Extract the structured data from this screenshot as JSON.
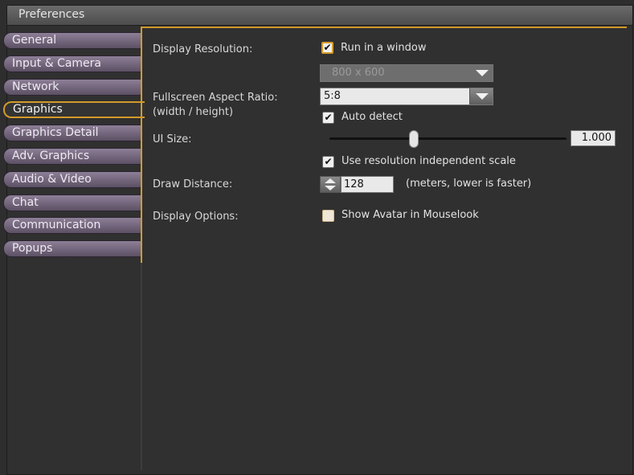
{
  "window": {
    "title": "Preferences"
  },
  "tabs": [
    {
      "label": "General"
    },
    {
      "label": "Input & Camera"
    },
    {
      "label": "Network"
    },
    {
      "label": "Graphics"
    },
    {
      "label": "Graphics Detail"
    },
    {
      "label": "Adv. Graphics"
    },
    {
      "label": "Audio & Video"
    },
    {
      "label": "Chat"
    },
    {
      "label": "Communication"
    },
    {
      "label": "Popups"
    }
  ],
  "active_tab": "Graphics",
  "graphics": {
    "display_resolution": {
      "label": "Display Resolution:",
      "run_in_window_label": "Run in a window",
      "run_in_window_checked": true,
      "resolution_value": "800 x 600"
    },
    "aspect_ratio": {
      "label": "Fullscreen Aspect Ratio:",
      "sublabel": "(width / height)",
      "value": "5:8",
      "auto_detect_label": "Auto detect",
      "auto_detect_checked": true
    },
    "ui_size": {
      "label": "UI Size:",
      "value": "1.000",
      "slider_fraction": 0.36,
      "res_independent_label": "Use resolution independent scale",
      "res_independent_checked": true
    },
    "draw_distance": {
      "label": "Draw Distance:",
      "value": "128",
      "hint": "(meters, lower is faster)"
    },
    "display_options": {
      "label": "Display Options:",
      "show_avatar_label": "Show Avatar in Mouselook",
      "show_avatar_checked": false
    }
  },
  "colors": {
    "accent": "#d39a2a",
    "tab": "#7a6c84",
    "background": "#303030"
  },
  "icons": {
    "check": "checkmark-icon",
    "dropdown": "dropdown-arrow-icon",
    "spinner": "spinner-arrows-icon"
  }
}
